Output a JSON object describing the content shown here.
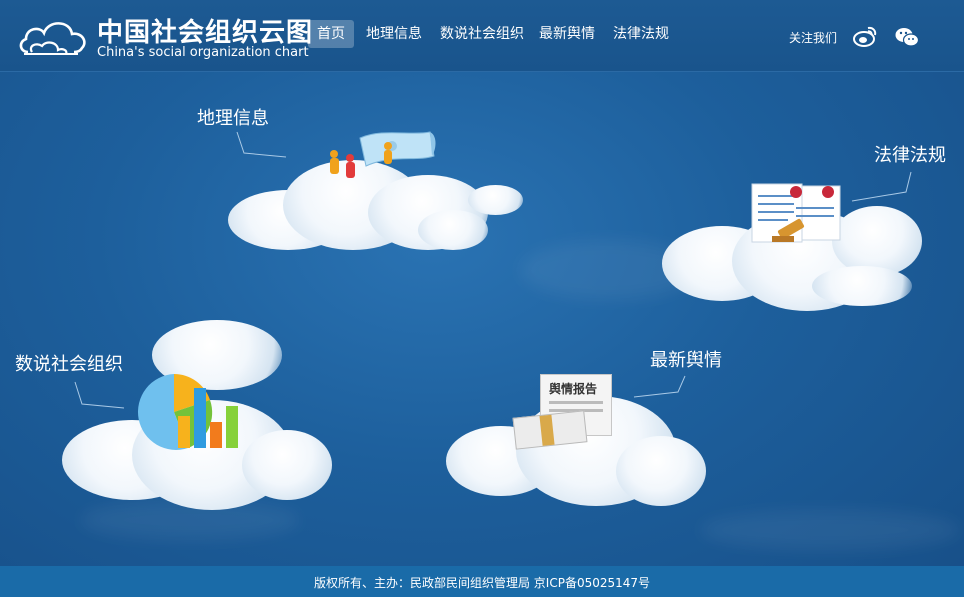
{
  "header": {
    "title": "中国社会组织云图",
    "subtitle": "China's social organization chart",
    "logo_icon": "cloud-icon",
    "nav": [
      {
        "label": "首页",
        "active": true
      },
      {
        "label": "地理信息",
        "active": false
      },
      {
        "label": "数说社会组织",
        "active": false
      },
      {
        "label": "最新舆情",
        "active": false
      },
      {
        "label": "法律法规",
        "active": false
      }
    ],
    "follow_label": "关注我们",
    "social_icons": [
      "weibo-icon",
      "wechat-icon"
    ]
  },
  "clouds": {
    "geo": {
      "label": "地理信息",
      "icon": "map-people-icon"
    },
    "law": {
      "label": "法律法规",
      "icon": "law-certificate-icon"
    },
    "stats": {
      "label": "数说社会组织",
      "icon": "pie-bar-chart-icon"
    },
    "news": {
      "label": "最新舆情",
      "icon": "newspaper-report-icon",
      "report_text": "舆情报告"
    }
  },
  "footer": {
    "text": "版权所有、主办：民政部民间组织管理局 京ICP备05025147号"
  },
  "colors": {
    "header_bg": "#19548c",
    "sky": "#1d5f9c",
    "footer_bg": "#1a6ba8",
    "nav_active_bg": "#5d8bb4"
  }
}
